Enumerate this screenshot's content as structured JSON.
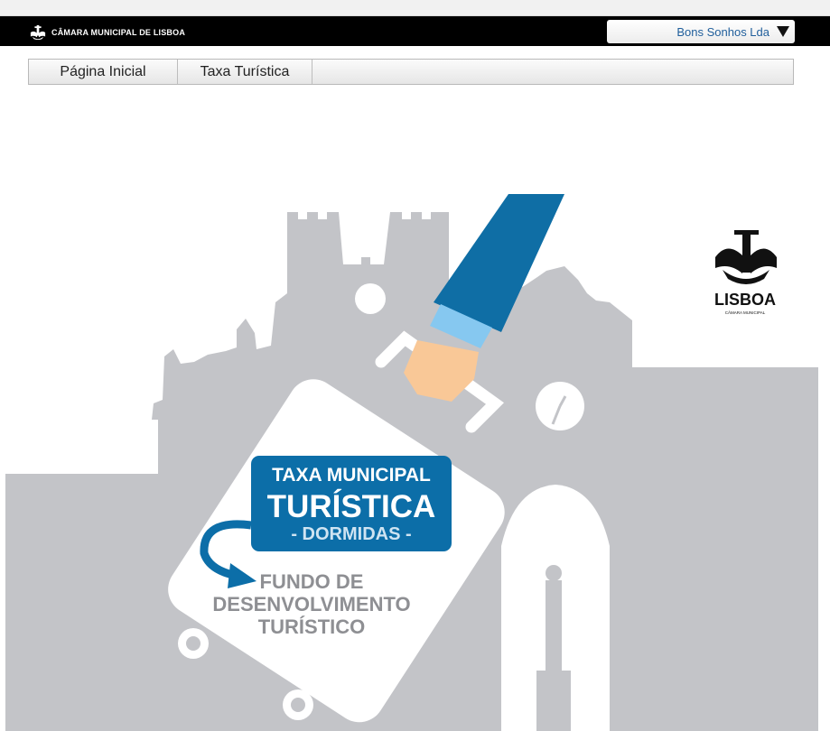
{
  "header": {
    "brand": "CÂMARA MUNICIPAL DE LISBOA",
    "user": "Bons Sonhos Lda"
  },
  "nav": {
    "items": [
      {
        "label": "Página Inicial"
      },
      {
        "label": "Taxa Turística"
      }
    ]
  },
  "banner": {
    "badge_line1": "TAXA MUNICIPAL",
    "badge_line2": "TURÍSTICA",
    "badge_line3": "- DORMIDAS -",
    "fund_line1": "FUNDO DE",
    "fund_line2": "DESENVOLVIMENTO",
    "fund_line3": "TURÍSTICO",
    "logo_text": "LISBOA",
    "logo_sub": "CÂMARA MUNICIPAL"
  },
  "colors": {
    "skyline": "#c3c4c8",
    "badge": "#0c6ea8",
    "sleeve": "#0f6ea5",
    "hand": "#f9c897",
    "fund_text": "#8e8f93"
  }
}
